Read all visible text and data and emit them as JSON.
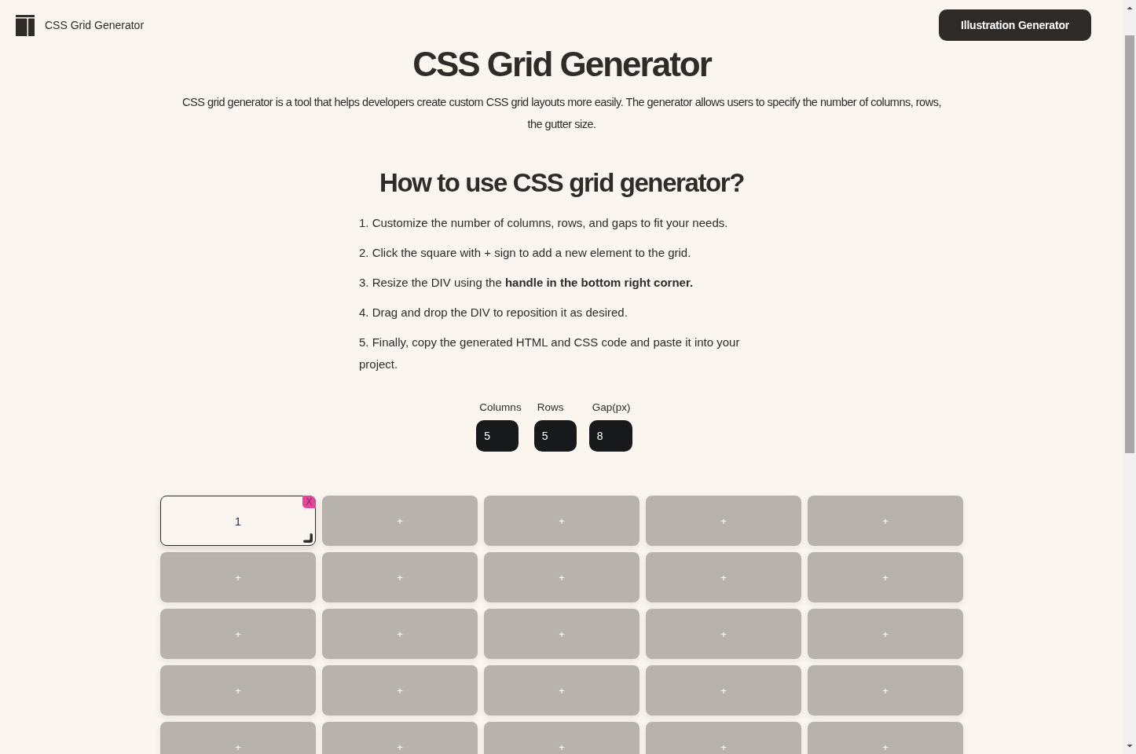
{
  "header": {
    "brand": "CSS Grid Generator",
    "button": "Illustration Generator"
  },
  "title": "CSS Grid Generator",
  "description": "CSS grid generator is a tool that helps developers create custom CSS grid layouts more easily. The generator allows users to specify the number of columns, rows, the gutter size.",
  "how_to": {
    "heading": "How to use CSS grid generator?",
    "steps": [
      "1. Customize the number of columns, rows, and gaps to fit your needs.",
      "2. Click the square with + sign to add a new element to the grid.",
      "3. Resize the DIV using the **handle in the bottom right corner.**",
      "4. Drag and drop the DIV to reposition it as desired.",
      "5. Finally, copy the generated HTML and CSS code and paste it into your project."
    ]
  },
  "controls": [
    {
      "label": "Columns",
      "value": "5"
    },
    {
      "label": "Rows",
      "value": "5"
    },
    {
      "label": "Gap(px)",
      "value": "8"
    }
  ],
  "grid": {
    "cells": [
      {
        "kind": "item",
        "label": "1",
        "remove": "X"
      },
      {
        "kind": "add",
        "label": "+"
      },
      {
        "kind": "add",
        "label": "+"
      },
      {
        "kind": "add",
        "label": "+"
      },
      {
        "kind": "add",
        "label": "+"
      },
      {
        "kind": "add",
        "label": "+"
      },
      {
        "kind": "add",
        "label": "+"
      },
      {
        "kind": "add",
        "label": "+"
      },
      {
        "kind": "add",
        "label": "+"
      },
      {
        "kind": "add",
        "label": "+"
      },
      {
        "kind": "add",
        "label": "+"
      },
      {
        "kind": "add",
        "label": "+"
      },
      {
        "kind": "add",
        "label": "+"
      },
      {
        "kind": "add",
        "label": "+"
      },
      {
        "kind": "add",
        "label": "+"
      },
      {
        "kind": "add",
        "label": "+"
      },
      {
        "kind": "add",
        "label": "+"
      },
      {
        "kind": "add",
        "label": "+"
      },
      {
        "kind": "add",
        "label": "+"
      },
      {
        "kind": "add",
        "label": "+"
      },
      {
        "kind": "add",
        "label": "+"
      },
      {
        "kind": "add",
        "label": "+"
      },
      {
        "kind": "add",
        "label": "+"
      },
      {
        "kind": "add",
        "label": "+"
      },
      {
        "kind": "add",
        "label": "+"
      }
    ]
  }
}
